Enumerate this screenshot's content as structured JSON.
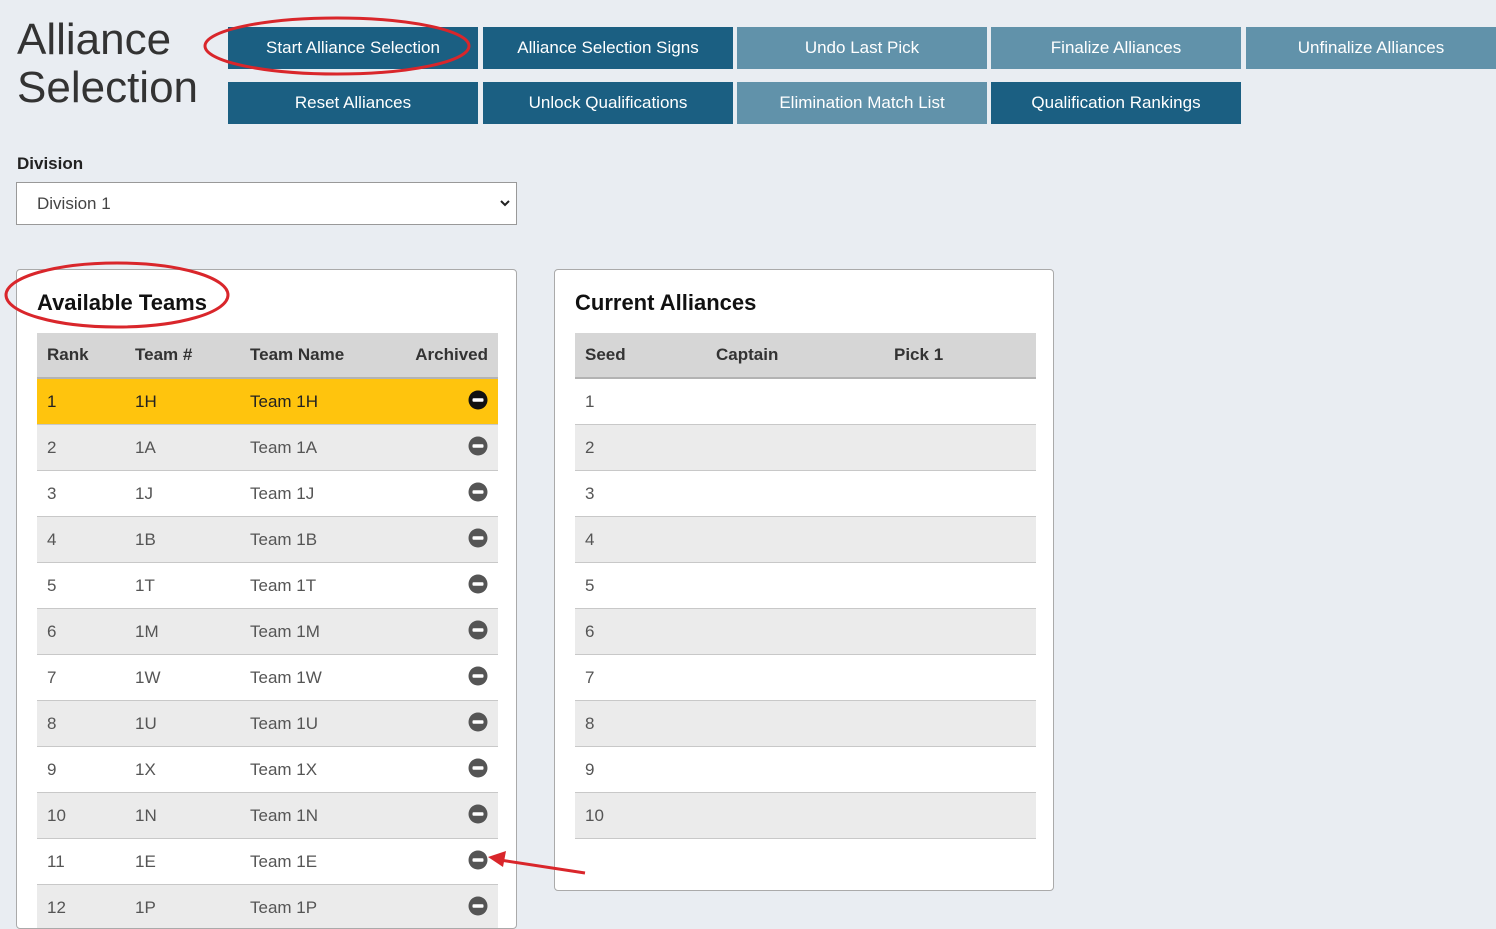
{
  "page": {
    "title_line1": "Alliance",
    "title_line2": "Selection"
  },
  "toolbar": {
    "buttons": [
      {
        "label": "Start Alliance Selection",
        "style": "dark"
      },
      {
        "label": "Alliance Selection Signs",
        "style": "dark"
      },
      {
        "label": "Undo Last Pick",
        "style": "light"
      },
      {
        "label": "Finalize Alliances",
        "style": "light"
      },
      {
        "label": "Unfinalize Alliances",
        "style": "light"
      },
      {
        "label": "Reset Alliances",
        "style": "dark"
      },
      {
        "label": "Unlock Qualifications",
        "style": "dark"
      },
      {
        "label": "Elimination Match List",
        "style": "light"
      },
      {
        "label": "Qualification Rankings",
        "style": "dark"
      }
    ]
  },
  "division": {
    "label": "Division",
    "selected": "Division 1"
  },
  "available_teams": {
    "title": "Available Teams",
    "columns": [
      "Rank",
      "Team #",
      "Team Name",
      "Archived"
    ],
    "rows": [
      {
        "rank": "1",
        "team": "1H",
        "name": "Team 1H",
        "highlight": true
      },
      {
        "rank": "2",
        "team": "1A",
        "name": "Team 1A"
      },
      {
        "rank": "3",
        "team": "1J",
        "name": "Team 1J"
      },
      {
        "rank": "4",
        "team": "1B",
        "name": "Team 1B"
      },
      {
        "rank": "5",
        "team": "1T",
        "name": "Team 1T"
      },
      {
        "rank": "6",
        "team": "1M",
        "name": "Team 1M"
      },
      {
        "rank": "7",
        "team": "1W",
        "name": "Team 1W"
      },
      {
        "rank": "8",
        "team": "1U",
        "name": "Team 1U"
      },
      {
        "rank": "9",
        "team": "1X",
        "name": "Team 1X"
      },
      {
        "rank": "10",
        "team": "1N",
        "name": "Team 1N"
      },
      {
        "rank": "11",
        "team": "1E",
        "name": "Team 1E"
      },
      {
        "rank": "12",
        "team": "1P",
        "name": "Team 1P"
      }
    ]
  },
  "current_alliances": {
    "title": "Current Alliances",
    "columns": [
      "Seed",
      "Captain",
      "Pick 1"
    ],
    "rows": [
      {
        "seed": "1",
        "captain": "",
        "pick1": ""
      },
      {
        "seed": "2",
        "captain": "",
        "pick1": ""
      },
      {
        "seed": "3",
        "captain": "",
        "pick1": ""
      },
      {
        "seed": "4",
        "captain": "",
        "pick1": ""
      },
      {
        "seed": "5",
        "captain": "",
        "pick1": ""
      },
      {
        "seed": "6",
        "captain": "",
        "pick1": ""
      },
      {
        "seed": "7",
        "captain": "",
        "pick1": ""
      },
      {
        "seed": "8",
        "captain": "",
        "pick1": ""
      },
      {
        "seed": "9",
        "captain": "",
        "pick1": ""
      },
      {
        "seed": "10",
        "captain": "",
        "pick1": ""
      }
    ]
  },
  "icons": {
    "archive": "minus-circle-icon",
    "dropdown": "chevron-down-icon"
  },
  "colors": {
    "button_dark": "#1b5f82",
    "button_light": "#6192aa",
    "highlight_row": "#ffc40d",
    "annotation": "#d9262b"
  }
}
